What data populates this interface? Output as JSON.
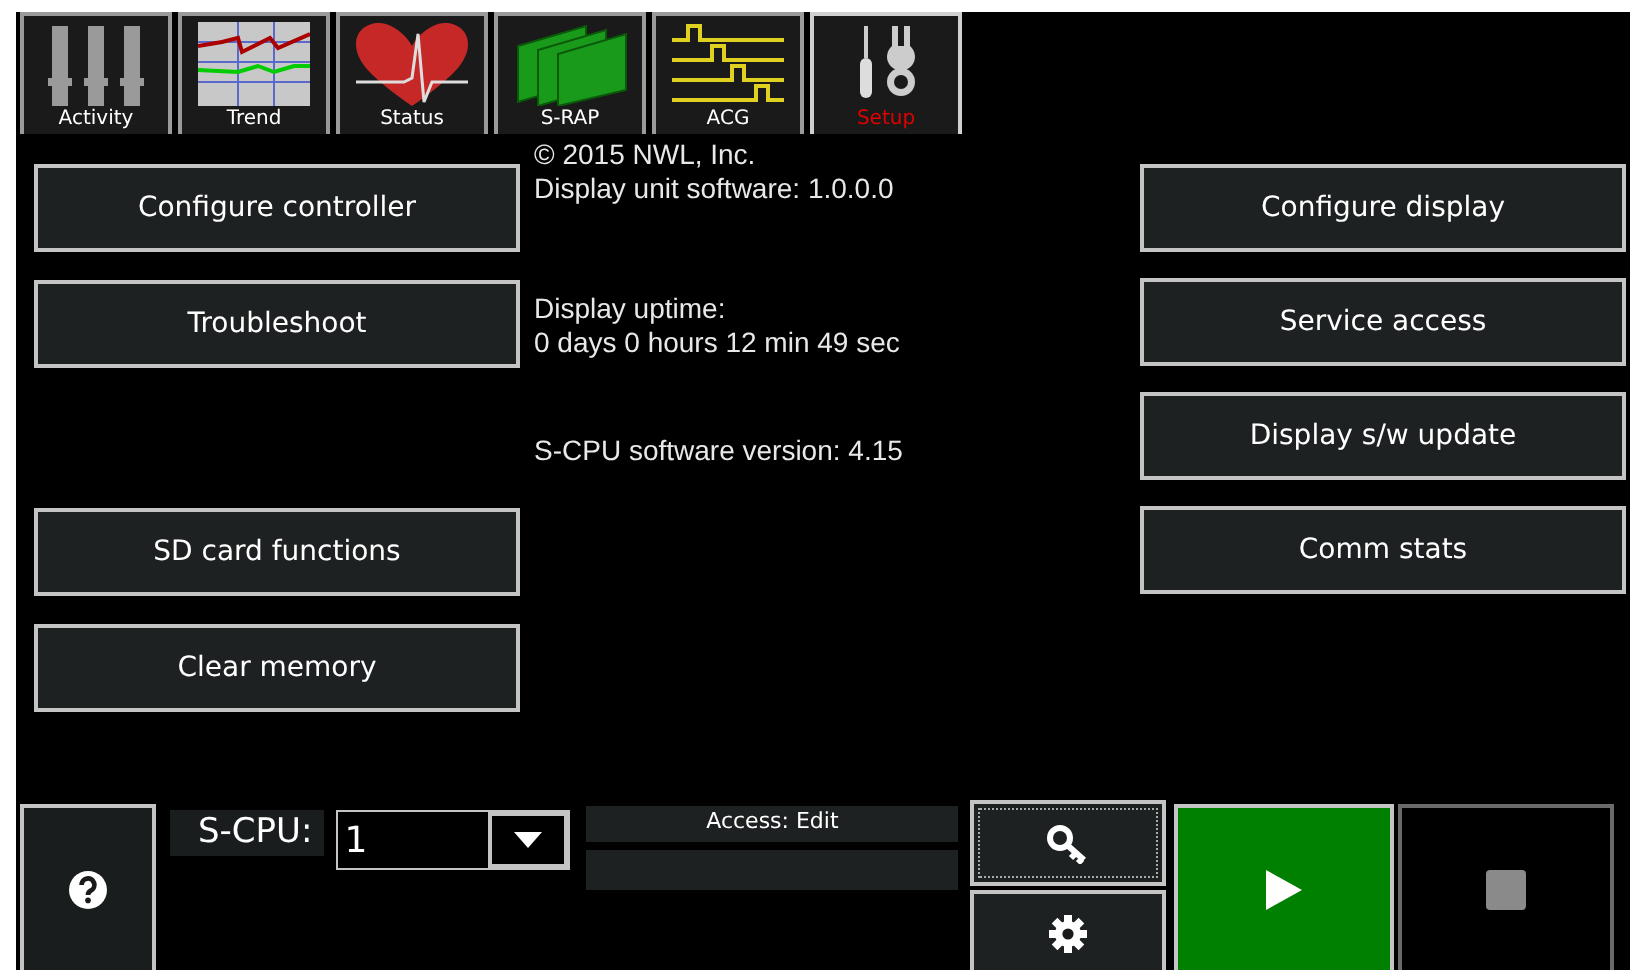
{
  "tabs": [
    {
      "label": "Activity",
      "selected": false
    },
    {
      "label": "Trend",
      "selected": false
    },
    {
      "label": "Status",
      "selected": false
    },
    {
      "label": "S-RAP",
      "selected": false
    },
    {
      "label": "ACG",
      "selected": false
    },
    {
      "label": "Setup",
      "selected": true
    }
  ],
  "left_buttons": [
    [
      "Configure controller",
      "Troubleshoot"
    ],
    [
      "SD card functions",
      "Clear memory"
    ]
  ],
  "info": [
    [
      "© 2015 NWL, Inc.",
      "Display unit software: 1.0.0.0"
    ],
    [
      "Display uptime:",
      "0 days 0 hours 12 min 49 sec"
    ],
    [
      "S-CPU software version: 4.15"
    ]
  ],
  "right_buttons": [
    "Configure display",
    "Service access",
    "Display s/w update",
    "Comm stats"
  ],
  "bottom": {
    "s_cpu_label": "S-CPU:",
    "s_cpu_value": "1",
    "access": "Access: Edit",
    "play": {
      "disabled": false
    },
    "stop": {
      "disabled": true
    }
  }
}
